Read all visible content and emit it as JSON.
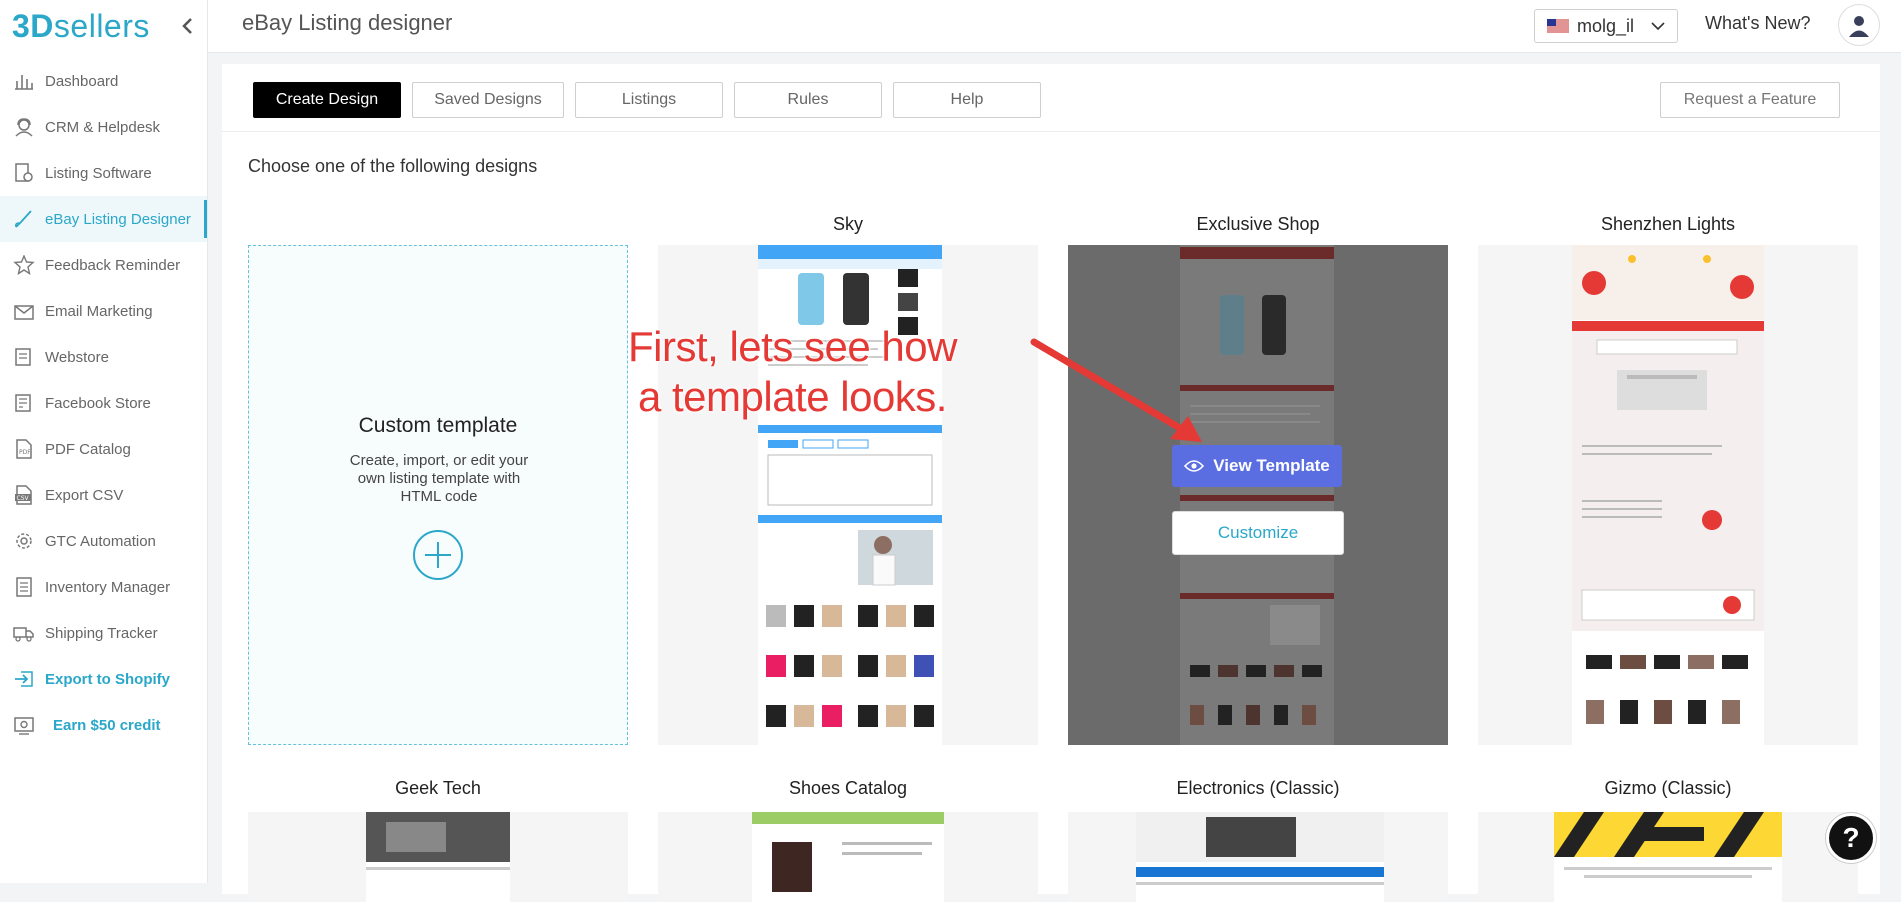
{
  "sidebar": {
    "logo_a": "3D",
    "logo_b": "sellers",
    "items": [
      {
        "label": "Dashboard"
      },
      {
        "label": "CRM & Helpdesk"
      },
      {
        "label": "Listing Software"
      },
      {
        "label": "eBay Listing Designer"
      },
      {
        "label": "Feedback Reminder"
      },
      {
        "label": "Email Marketing"
      },
      {
        "label": "Webstore"
      },
      {
        "label": "Facebook Store"
      },
      {
        "label": "PDF Catalog"
      },
      {
        "label": "Export CSV"
      },
      {
        "label": "GTC Automation"
      },
      {
        "label": "Inventory Manager"
      },
      {
        "label": "Shipping Tracker"
      },
      {
        "label": "Export to Shopify"
      },
      {
        "label": "Earn $50 credit"
      }
    ]
  },
  "header": {
    "title": "eBay Listing designer",
    "user": "molg_il",
    "whats_new": "What's New?"
  },
  "tabs": [
    {
      "label": "Create Design"
    },
    {
      "label": "Saved Designs"
    },
    {
      "label": "Listings"
    },
    {
      "label": "Rules"
    },
    {
      "label": "Help"
    }
  ],
  "request_feature": "Request a Feature",
  "choose_text": "Choose one of the following designs",
  "custom_template": {
    "title": "Custom template",
    "description": "Create, import, or edit your own listing template with HTML code"
  },
  "templates_row1": [
    "Sky",
    "Exclusive Shop",
    "Shenzhen Lights"
  ],
  "templates_row2": [
    "Geek Tech",
    "Shoes Catalog",
    "Electronics (Classic)",
    "Gizmo (Classic)"
  ],
  "hover": {
    "view_template": "View Template",
    "customize": "Customize"
  },
  "annotation": {
    "line1": "First, lets see how",
    "line2": "a template looks."
  },
  "help_icon": "?",
  "colors": {
    "accent": "#2aa7c9",
    "view_button": "#5b6ee1",
    "annotation": "#e53935"
  }
}
